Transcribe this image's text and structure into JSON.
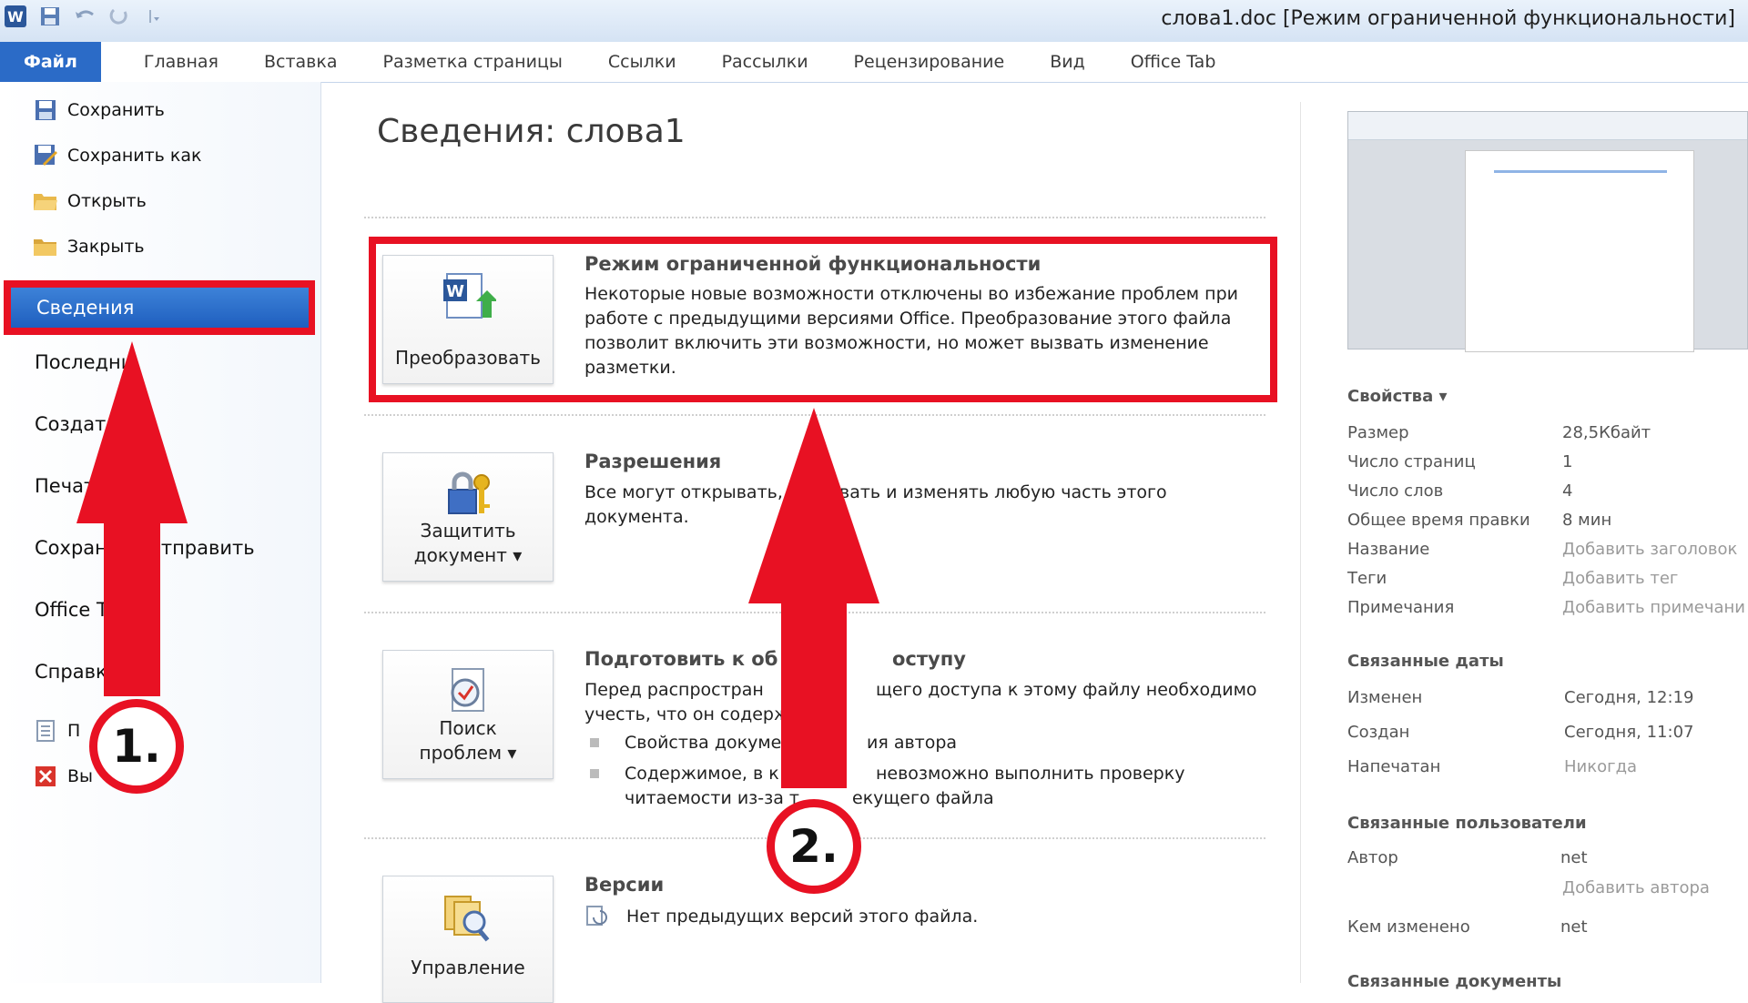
{
  "window": {
    "title": "слова1.doc [Режим ограниченной функциональности]"
  },
  "ribbon": {
    "tabs": [
      "Файл",
      "Главная",
      "Вставка",
      "Разметка страницы",
      "Ссылки",
      "Рассылки",
      "Рецензирование",
      "Вид",
      "Office Tab"
    ]
  },
  "nav": {
    "save": "Сохранить",
    "save_as": "Сохранить как",
    "open": "Открыть",
    "close": "Закрыть",
    "info": "Сведения",
    "recent": "Последни",
    "create": "Создат",
    "print": "Печат",
    "save_send_a": "Сохран",
    "save_send_b": "отправить",
    "office_tab": "Office T",
    "help": "Справк",
    "options": "П",
    "exit": "Вы"
  },
  "main": {
    "page_title": "Сведения: слова1",
    "compat": {
      "button": "Преобразовать",
      "title": "Режим ограниченной функциональности",
      "text": [
        "Некоторые новые возможности отключены во избежание проблем при",
        "работе с предыдущими версиями Office. Преобразование этого файла",
        "позволит включить эти возможности, но может вызвать изменение",
        "разметки."
      ]
    },
    "permissions": {
      "button_l1": "Защитить",
      "button_l2": "документ ▾",
      "title": "Разрешения",
      "text_a": "Все могут открывать,",
      "text_b": "вать и изменять любую часть этого",
      "text_c": "документа."
    },
    "prepare": {
      "button_l1": "Поиск",
      "button_l2": "проблем ▾",
      "title_a": "Подготовить к об",
      "title_b": "оступу",
      "text_a1": "Перед распростран",
      "text_a2": "щего доступа к этому файлу необходимо",
      "text_b": "учесть, что он содерж",
      "bullet1_a": "Свойства докуме",
      "bullet1_b": "ия автора",
      "bullet2_a": "Содержимое, в к",
      "bullet2_b": "невозможно выполнить проверку",
      "bullet2_c": "читаемости из-за т",
      "bullet2_d": "екущего файла"
    },
    "versions": {
      "button_l1": "Управление",
      "title": "Версии",
      "text": "Нет предыдущих версий этого файла."
    }
  },
  "properties": {
    "heading": "Свойства ▾",
    "rows": [
      {
        "label": "Размер",
        "value": "28,5Кбайт"
      },
      {
        "label": "Число страниц",
        "value": "1"
      },
      {
        "label": "Число слов",
        "value": "4"
      },
      {
        "label": "Общее время правки",
        "value": "8 мин"
      },
      {
        "label": "Название",
        "value": "Добавить заголовок"
      },
      {
        "label": "Теги",
        "value": "Добавить тег"
      },
      {
        "label": "Примечания",
        "value": "Добавить примечани"
      }
    ],
    "dates_heading": "Связанные даты",
    "dates": [
      {
        "label": "Изменен",
        "value": "Сегодня, 12:19"
      },
      {
        "label": "Создан",
        "value": "Сегодня, 11:07"
      },
      {
        "label": "Напечатан",
        "value": "Никогда"
      }
    ],
    "people_heading": "Связанные пользователи",
    "author_label": "Автор",
    "author_value": "net",
    "add_author": "Добавить автора",
    "modified_by_label": "Кем изменено",
    "modified_by_value": "net",
    "docs_heading": "Связанные документы"
  },
  "annotations": {
    "step1": "1.",
    "step2": "2."
  },
  "colors": {
    "accent_red": "#e81123",
    "file_tab_blue": "#2b6bc7"
  }
}
